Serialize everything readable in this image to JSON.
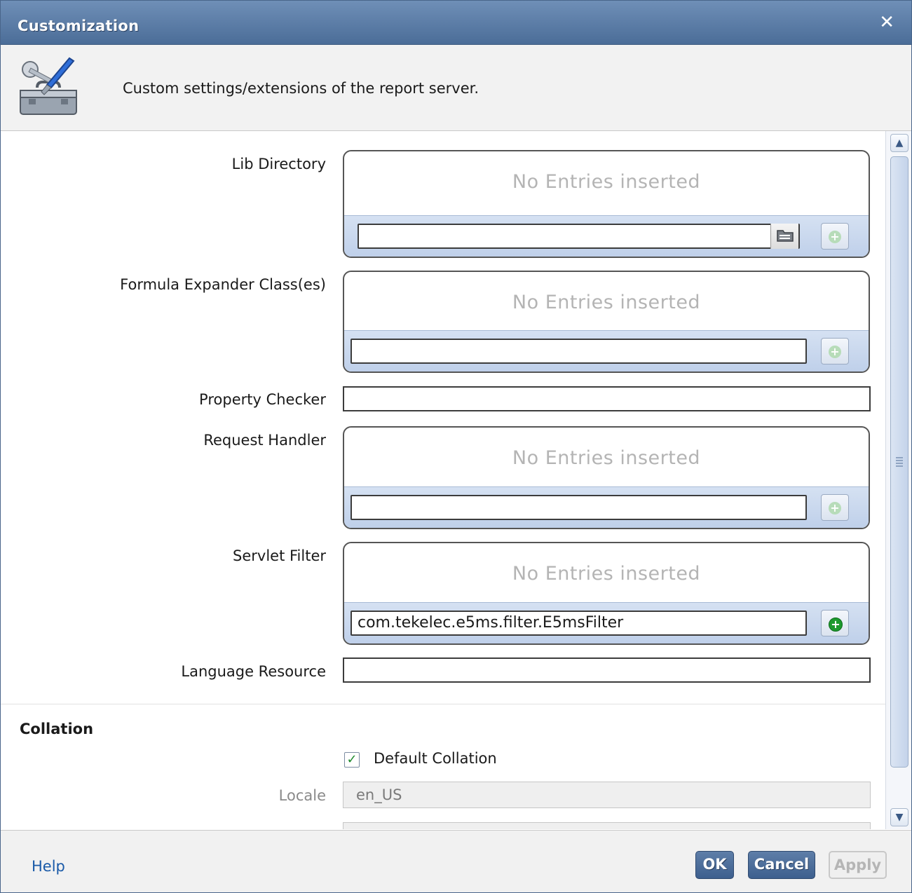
{
  "dialog": {
    "title": "Customization",
    "close_icon": "close-x",
    "description": "Custom settings/extensions of the report server."
  },
  "fields": {
    "lib_directory": {
      "label": "Lib Directory",
      "empty_text": "No Entries inserted",
      "input_value": ""
    },
    "formula_expander": {
      "label": "Formula Expander Class(es)",
      "empty_text": "No Entries inserted",
      "input_value": ""
    },
    "property_checker": {
      "label": "Property Checker",
      "value": ""
    },
    "request_handler": {
      "label": "Request Handler",
      "empty_text": "No Entries inserted",
      "input_value": ""
    },
    "servlet_filter": {
      "label": "Servlet Filter",
      "empty_text": "No Entries inserted",
      "input_value": "com.tekelec.e5ms.filter.E5msFilter"
    },
    "language_resource": {
      "label": "Language Resource",
      "value": ""
    }
  },
  "collation": {
    "section_title": "Collation",
    "default_label": "Default Collation",
    "default_checked": true,
    "locale_label": "Locale",
    "locale_value": "en_US"
  },
  "footer": {
    "help": "Help",
    "ok": "OK",
    "cancel": "Cancel",
    "apply": "Apply"
  },
  "colors": {
    "titlebar": "#4b6d98",
    "primary_button": "#3d5f8e",
    "add_enabled": "#1d9a2e"
  }
}
